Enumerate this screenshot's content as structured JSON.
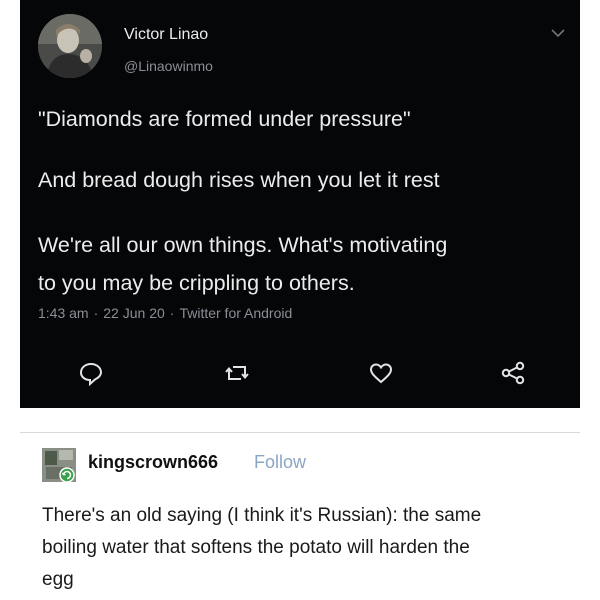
{
  "tweet": {
    "display_name": "Victor Linao",
    "handle": "@Linaowinmo",
    "lines": [
      "\"Diamonds are formed under pressure\"",
      "And bread dough rises when you let it rest",
      "We're all our own things. What's motivating",
      "to you may be crippling to others."
    ],
    "time": "1:43 am",
    "date": "22 Jun 20",
    "source": "Twitter for Android",
    "separator": "·",
    "icons": {
      "menu": "chevron-down-icon",
      "reply": "reply-icon",
      "retweet": "retweet-icon",
      "like": "heart-icon",
      "share": "share-icon"
    },
    "colors": {
      "background": "#050608",
      "text": "#ececec",
      "muted": "#8a8f96"
    }
  },
  "reply": {
    "username": "kingscrown666",
    "follow_label": "Follow",
    "lines": [
      "There's an old saying (I think it's Russian): the same",
      "boiling water that softens the potato will harden the",
      "egg"
    ],
    "colors": {
      "follow": "#8aa6c4",
      "text": "#1a1a1a"
    }
  }
}
